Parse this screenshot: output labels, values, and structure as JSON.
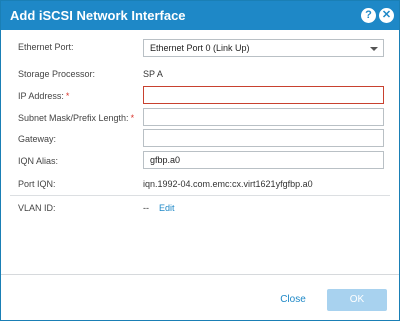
{
  "dialog": {
    "title": "Add iSCSI Network Interface",
    "help_icon": "?",
    "close_icon": "✕"
  },
  "form": {
    "ethernet_port_label": "Ethernet Port:",
    "ethernet_port_value": "Ethernet Port 0 (Link Up)",
    "storage_processor_label": "Storage Processor:",
    "storage_processor_value": "SP A",
    "ip_address_label": "IP Address:",
    "ip_address_value": "",
    "subnet_label": "Subnet Mask/Prefix Length:",
    "subnet_value": "",
    "gateway_label": "Gateway:",
    "gateway_value": "",
    "iqn_alias_label": "IQN Alias:",
    "iqn_alias_value": "gfbp.a0",
    "port_iqn_label": "Port IQN:",
    "port_iqn_value": "iqn.1992-04.com.emc:cx.virt1621yfgfbp.a0",
    "vlan_id_label": "VLAN ID:",
    "vlan_id_value": "--",
    "vlan_edit_label": "Edit",
    "required_marker": "*"
  },
  "footer": {
    "close_label": "Close",
    "ok_label": "OK"
  },
  "colors": {
    "accent": "#1e88c7",
    "error_border": "#c8412f",
    "required": "#d9342b",
    "ok_disabled": "#a8d2ef"
  }
}
